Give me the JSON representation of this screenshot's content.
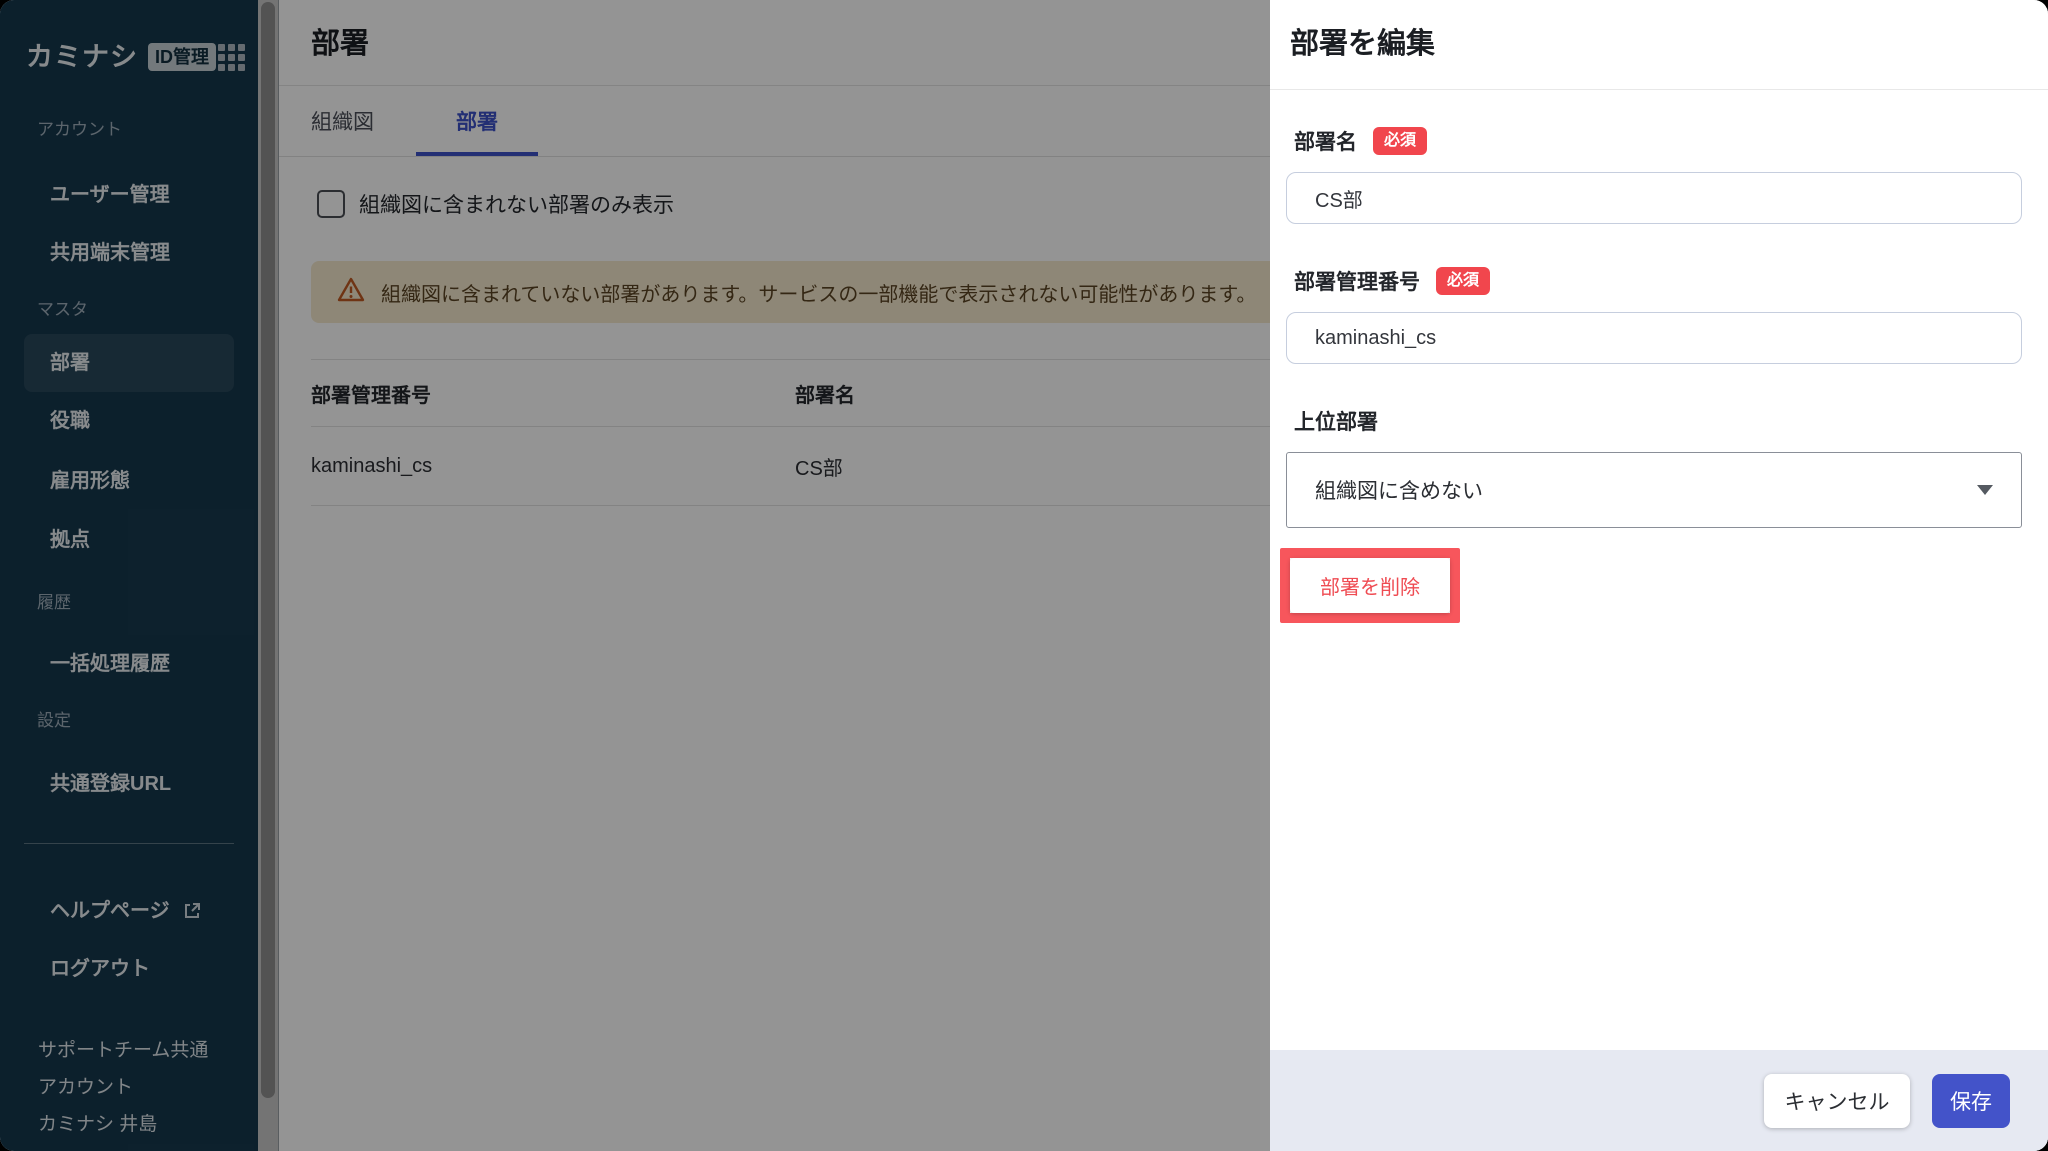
{
  "app": {
    "brand": "カミナシ",
    "brand_badge": "ID管理"
  },
  "sidebar": {
    "sections": [
      {
        "label": "アカウント",
        "items": [
          {
            "label": "ユーザー管理"
          },
          {
            "label": "共用端末管理"
          }
        ]
      },
      {
        "label": "マスタ",
        "items": [
          {
            "label": "部署",
            "active": true
          },
          {
            "label": "役職"
          },
          {
            "label": "雇用形態"
          },
          {
            "label": "拠点"
          }
        ]
      },
      {
        "label": "履歴",
        "items": [
          {
            "label": "一括処理履歴"
          }
        ]
      },
      {
        "label": "設定",
        "items": [
          {
            "label": "共通登録URL"
          }
        ]
      }
    ],
    "footer": {
      "help_label": "ヘルプページ",
      "logout_label": "ログアウト",
      "account_name": "サポートチーム共通アカウント",
      "user_name": "カミナシ 井島"
    }
  },
  "main": {
    "title": "部署",
    "tabs": [
      {
        "label": "組織図",
        "active": false
      },
      {
        "label": "部署",
        "active": true
      }
    ],
    "filter_checkbox": {
      "label": "組織図に含まれない部署のみ表示",
      "checked": false
    },
    "warning_text": "組織図に含まれていない部署があります。サービスの一部機能で表示されない可能性があります。",
    "table": {
      "columns": [
        "部署管理番号",
        "部署名"
      ],
      "rows": [
        [
          "kaminashi_cs",
          "CS部"
        ]
      ]
    }
  },
  "drawer": {
    "title": "部署を編集",
    "required_badge": "必須",
    "fields": {
      "name": {
        "label": "部署名",
        "value": "CS部"
      },
      "code": {
        "label": "部署管理番号",
        "value": "kaminashi_cs"
      },
      "parent": {
        "label": "上位部署",
        "value": "組織図に含めない"
      }
    },
    "delete_label": "部署を削除",
    "cancel_label": "キャンセル",
    "save_label": "保存"
  },
  "icons": {
    "app_grid": "app-grid-icon",
    "external_link": "external-link-icon",
    "warning": "warning-triangle-icon",
    "caret": "chevron-down-icon"
  },
  "colors": {
    "accent": "#4353C9",
    "tab_accent": "#3D52C8",
    "danger_badge": "#F1464D",
    "annotation_red": "#F7565C",
    "warning_bg": "#F5E9CE",
    "warning_icon": "#C05B24",
    "sidebar_bg": "#16384D",
    "drawer_footer_bg": "#E6E9F2"
  }
}
